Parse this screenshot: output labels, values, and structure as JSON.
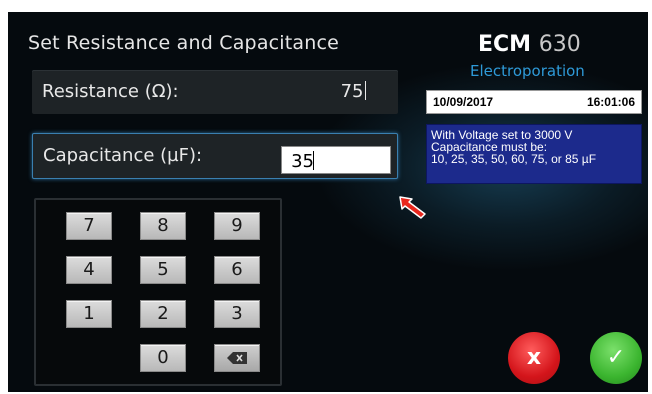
{
  "screen": {
    "title": "Set Resistance and Capacitance",
    "brand": {
      "name": "ECM",
      "model": "630",
      "subtitle": "Electroporation"
    },
    "datetime": {
      "date": "10/09/2017",
      "time": "16:01:06"
    },
    "info": {
      "line1": "With Voltage set to 3000 V",
      "line2": "Capacitance must be:",
      "line3": "10, 25, 35, 50, 60, 75, or 85 µF"
    },
    "resistance": {
      "label": "Resistance (Ω):",
      "value": "75"
    },
    "capacitance": {
      "label": "Capacitance (µF):",
      "value": "35"
    },
    "keypad": {
      "k7": "7",
      "k8": "8",
      "k9": "9",
      "k4": "4",
      "k5": "5",
      "k6": "6",
      "k1": "1",
      "k2": "2",
      "k3": "3",
      "k0": "0",
      "backspace_icon": "backspace-icon"
    },
    "buttons": {
      "cancel": "x",
      "confirm": "✓",
      "cancel_color": "#d4151b",
      "confirm_color": "#3bb52f"
    },
    "accent_color": "#2e9ad8",
    "pointer_icon": "arrow-pointer-icon"
  }
}
